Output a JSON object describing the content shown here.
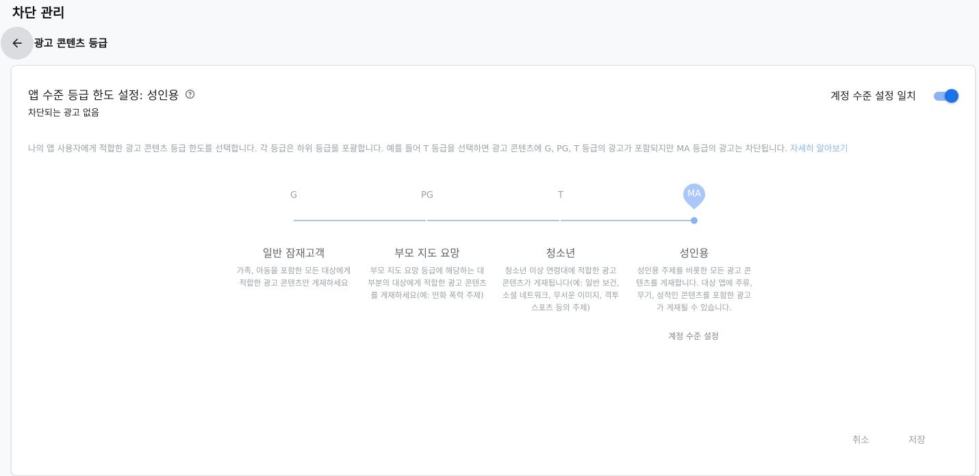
{
  "page_title": "차단 관리",
  "sub_title": "광고 콘텐츠 등급",
  "card": {
    "title": "앱 수준 등급 한도 설정: 성인용",
    "subtitle": "차단되는 광고 없음",
    "toggle_label": "계정 수준 설정 일치",
    "toggle_on": true,
    "description": "나의 앱 사용자에게 적합한 광고 콘텐츠 등급 한도를 선택합니다. 각 등급은 하위 등급을 포괄합니다. 예를 들어 T 등급을 선택하면 광고 콘텐츠에 G, PG, T 등급의 광고가 포함되지만 MA 등급의 광고는 차단됩니다.",
    "learn_more": "자세히 알아보기"
  },
  "levels": [
    {
      "abbr": "G",
      "name": "일반 잠재고객",
      "desc": "가족, 아동을 포함한 모든 대상에게 적합한 광고 콘텐츠만 게재하세요"
    },
    {
      "abbr": "PG",
      "name": "부모 지도 요망",
      "desc": "부모 지도 요망 등급에 해당하는 대부분의 대상에게 적합한 광고 콘텐츠를 게재하세요(예: 만화 폭력 주제)"
    },
    {
      "abbr": "T",
      "name": "청소년",
      "desc": "청소년 이상 연령대에 적합한 광고 콘텐츠가 게재됩니다(예: 일반 보건, 소셜 네트워크, 무서운 이미지, 격투 스포츠 등의 주제)"
    },
    {
      "abbr": "MA",
      "name": "성인용",
      "desc": "성인용 주제를 비롯한 모든 광고 콘텐츠를 게재합니다. 대상 앱에 주류, 무기, 성적인 콘텐츠를 포함한 광고가 게재될 수 있습니다."
    }
  ],
  "selected_level": "MA",
  "account_level_note": "계정 수준 설정",
  "footer": {
    "cancel": "취소",
    "save": "저장"
  },
  "colors": {
    "accent": "#1a73e8",
    "accent_light": "#8ab4f8",
    "muted_text": "#9aa0a6"
  },
  "icons": {
    "back": "arrow-back-icon",
    "help": "help-circle-icon"
  }
}
